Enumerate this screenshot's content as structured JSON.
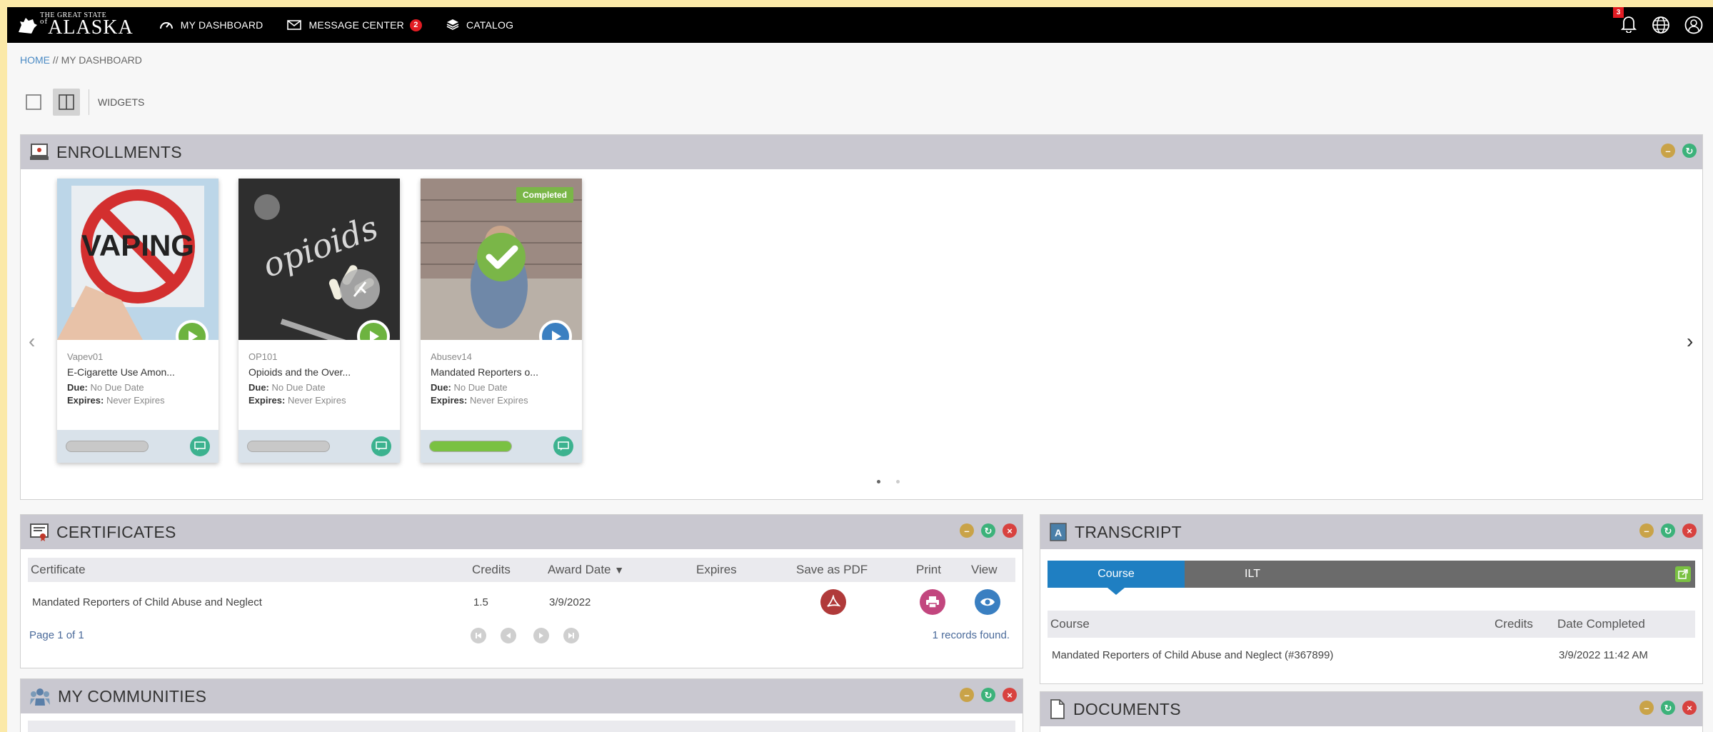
{
  "nav": {
    "logo_small": "THE GREAT STATE",
    "logo_of": "of",
    "logo_big": "ALASKA",
    "dashboard": "MY DASHBOARD",
    "messages": "MESSAGE CENTER",
    "messages_count": "2",
    "catalog": "CATALOG",
    "notif_count": "3"
  },
  "breadcrumb": {
    "home": "HOME",
    "sep": " // ",
    "current": "MY DASHBOARD"
  },
  "toolbar": {
    "widgets": "WIDGETS"
  },
  "enrollments": {
    "title": "ENROLLMENTS",
    "due_label": "Due:",
    "expires_label": "Expires:",
    "completed_badge": "Completed",
    "cards": [
      {
        "code": "Vapev01",
        "name": "E-Cigarette Use Amon...",
        "due": "No Due Date",
        "expires": "Never Expires",
        "progress": 0,
        "art_text": "VAPING"
      },
      {
        "code": "OP101",
        "name": "Opioids and the Over...",
        "due": "No Due Date",
        "expires": "Never Expires",
        "progress": 0,
        "art_text": "opioids"
      },
      {
        "code": "Abusev14",
        "name": "Mandated Reporters o...",
        "due": "No Due Date",
        "expires": "Never Expires",
        "progress": 1
      }
    ]
  },
  "certificates": {
    "title": "CERTIFICATES",
    "columns": [
      "Certificate",
      "Credits",
      "Award Date",
      "Expires",
      "Save as PDF",
      "Print",
      "View"
    ],
    "rows": [
      {
        "certificate": "Mandated Reporters of Child Abuse and Neglect",
        "credits": "1.5",
        "award_date": "3/9/2022",
        "expires": ""
      }
    ],
    "page": "Page 1 of 1",
    "records": "1 records found."
  },
  "transcript": {
    "title": "TRANSCRIPT",
    "tabs": [
      "Course",
      "ILT"
    ],
    "columns": [
      "Course",
      "Credits",
      "Date Completed"
    ],
    "rows": [
      {
        "course": "Mandated Reporters of Child Abuse and Neglect (#367899)",
        "credits": "",
        "date": "3/9/2022 11:42 AM"
      }
    ]
  },
  "communities": {
    "title": "MY COMMUNITIES"
  },
  "documents": {
    "title": "DOCUMENTS"
  },
  "colors": {
    "nav_bg": "#000000",
    "panel_head": "#c9c8d0",
    "accent_blue": "#1f7fc2",
    "progress_green": "#7ac142"
  }
}
